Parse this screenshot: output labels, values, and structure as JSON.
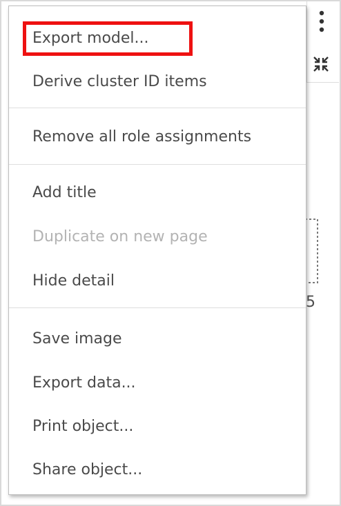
{
  "menu": {
    "items": [
      {
        "label": "Export model...",
        "disabled": false,
        "highlighted": true
      },
      {
        "label": "Derive cluster ID items",
        "disabled": false
      },
      {
        "label": "Remove all role assignments",
        "disabled": false
      },
      {
        "label": "Add title",
        "disabled": false
      },
      {
        "label": "Duplicate on new page",
        "disabled": true
      },
      {
        "label": "Hide detail",
        "disabled": false
      },
      {
        "label": "Save image",
        "disabled": false
      },
      {
        "label": "Export data...",
        "disabled": false
      },
      {
        "label": "Print object...",
        "disabled": false
      },
      {
        "label": "Share object...",
        "disabled": false
      }
    ]
  },
  "background": {
    "more_icon": "more-vertical-icon",
    "collapse_icon": "collapse-icon",
    "fragment_text": "5"
  },
  "colors": {
    "highlight": "#ee1111",
    "text": "#4a4a4a",
    "disabled_text": "#b3b3b3"
  }
}
